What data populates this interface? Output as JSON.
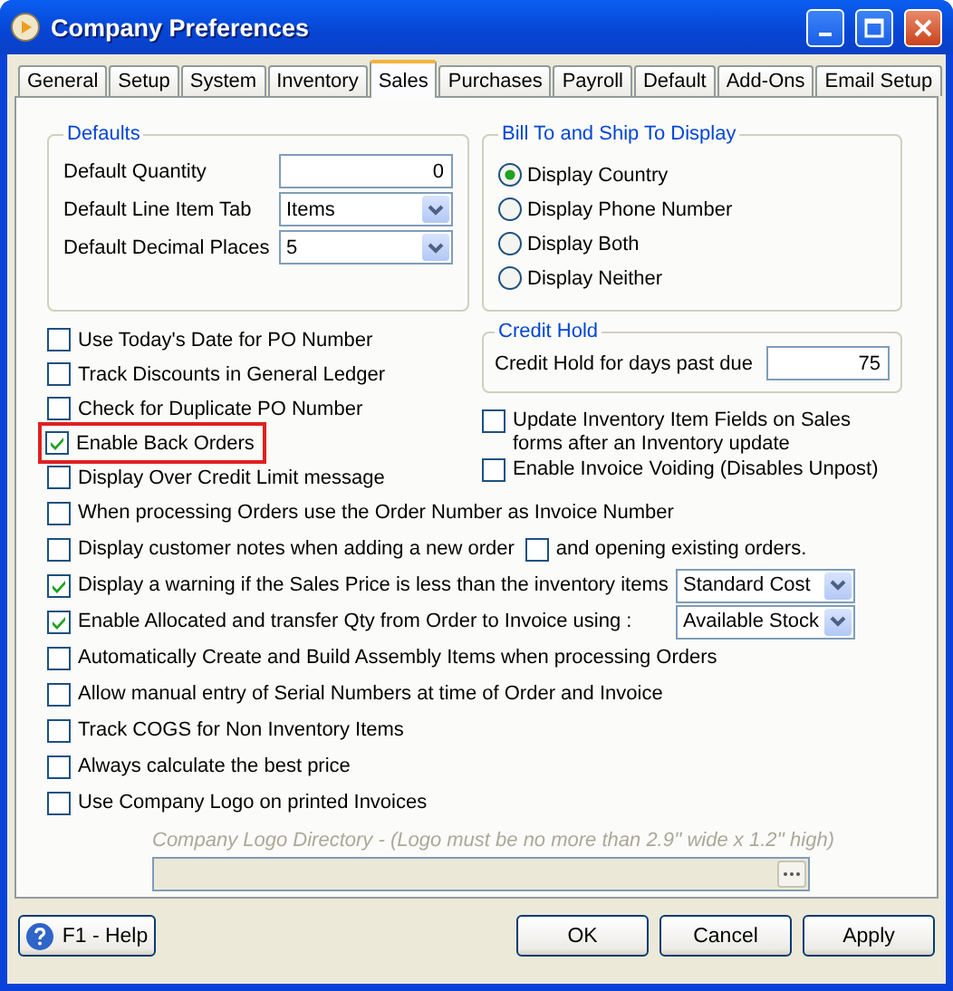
{
  "window": {
    "title": "Company Preferences"
  },
  "tabs": [
    {
      "label": "General",
      "selected": false
    },
    {
      "label": "Setup",
      "selected": false
    },
    {
      "label": "System",
      "selected": false
    },
    {
      "label": "Inventory",
      "selected": false
    },
    {
      "label": "Sales",
      "selected": true
    },
    {
      "label": "Purchases",
      "selected": false
    },
    {
      "label": "Payroll",
      "selected": false
    },
    {
      "label": "Default",
      "selected": false
    },
    {
      "label": "Add-Ons",
      "selected": false
    },
    {
      "label": "Email Setup",
      "selected": false
    }
  ],
  "defaults": {
    "title": "Defaults",
    "fields": [
      {
        "label": "Default Quantity",
        "kind": "number",
        "value": "0"
      },
      {
        "label": "Default Line Item Tab",
        "kind": "dropdown",
        "value": "Items"
      },
      {
        "label": "Default Decimal Places",
        "kind": "dropdown",
        "value": "5"
      }
    ]
  },
  "bill_to": {
    "title": "Bill To and Ship To Display",
    "options": [
      {
        "label": "Display Country",
        "selected": true
      },
      {
        "label": "Display Phone Number",
        "selected": false
      },
      {
        "label": "Display Both",
        "selected": false
      },
      {
        "label": "Display Neither",
        "selected": false
      }
    ]
  },
  "left_options": [
    {
      "label": "Use Today's Date for PO Number",
      "checked": false,
      "highlighted": false
    },
    {
      "label": "Track Discounts in General Ledger",
      "checked": false,
      "highlighted": false
    },
    {
      "label": "Check for Duplicate PO Number",
      "checked": false,
      "highlighted": false
    },
    {
      "label": "Enable Back Orders",
      "checked": true,
      "highlighted": true
    },
    {
      "label": "Display Over Credit Limit message",
      "checked": false,
      "highlighted": false
    }
  ],
  "credit_hold": {
    "title": "Credit Hold",
    "label": "Credit Hold for days past due",
    "value": "75"
  },
  "right_options": [
    {
      "label": "Update Inventory Item Fields on Sales forms after an Inventory update",
      "checked": false
    },
    {
      "label": "Enable Invoice Voiding (Disables Unpost)",
      "checked": false
    }
  ],
  "options": [
    {
      "kind": "checkbox",
      "label": "When processing Orders use the Order Number as Invoice Number",
      "checked": false
    },
    {
      "kind": "pair",
      "label": "Display customer notes when adding a new order",
      "checked": false,
      "second": {
        "label": "and opening existing orders.",
        "checked": false
      }
    },
    {
      "kind": "dropdown",
      "label": "Display a warning if the Sales Price is less than the inventory items",
      "checked": true,
      "value": "Standard Cost"
    },
    {
      "kind": "dropdown",
      "label": "Enable Allocated and transfer Qty from Order to Invoice using :",
      "checked": true,
      "value": "Available Stock"
    },
    {
      "kind": "checkbox",
      "label": "Automatically Create and Build Assembly Items when processing Orders",
      "checked": false
    },
    {
      "kind": "checkbox",
      "label": "Allow manual entry of Serial Numbers at time of Order and Invoice",
      "checked": false
    },
    {
      "kind": "checkbox",
      "label": "Track COGS for Non Inventory Items",
      "checked": false
    },
    {
      "kind": "checkbox",
      "label": "Always calculate the best price",
      "checked": false
    },
    {
      "kind": "checkbox",
      "label": "Use Company Logo on printed Invoices",
      "checked": false
    }
  ],
  "logo_directory": {
    "label": "Company Logo Directory - (Logo must be no more than 2.9'' wide x 1.2'' high)",
    "disabled": true
  },
  "footer": {
    "help": "F1 - Help",
    "buttons": [
      "OK",
      "Cancel",
      "Apply"
    ]
  }
}
